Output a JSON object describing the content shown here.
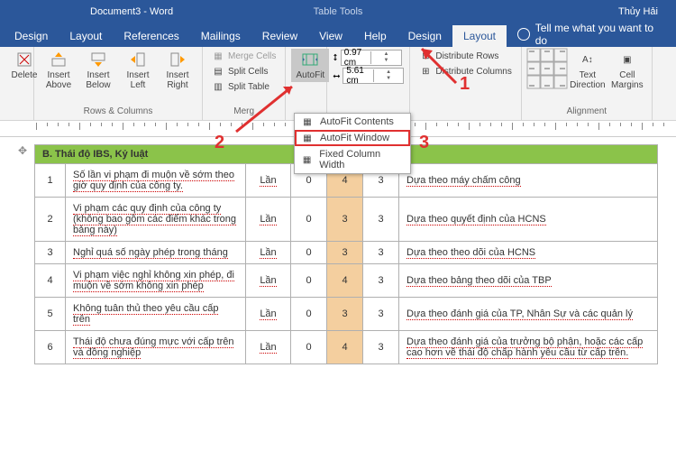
{
  "title": {
    "doc": "Document3  -  Word",
    "tools": "Table Tools",
    "user": "Thủy Hải"
  },
  "tabs": [
    "Design",
    "Layout",
    "References",
    "Mailings",
    "Review",
    "View",
    "Help",
    "Design",
    "Layout"
  ],
  "active_tab": 8,
  "tell_me": "Tell me what you want to do",
  "ribbon": {
    "delete": "Delete",
    "insert_above": "Insert Above",
    "insert_below": "Insert Below",
    "insert_left": "Insert Left",
    "insert_right": "Insert Right",
    "rows_cols": "Rows & Columns",
    "merge_cells": "Merge Cells",
    "split_cells": "Split Cells",
    "split_table": "Split Table",
    "merge": "Merg",
    "autofit": "AutoFit",
    "h": "0.97 cm",
    "w": "5.61 cm",
    "dist_rows": "Distribute Rows",
    "dist_cols": "Distribute Columns",
    "text_dir": "Text Direction",
    "cell_marg": "Cell Margins",
    "alignment": "Alignment"
  },
  "dropdown": {
    "a": "AutoFit Contents",
    "b": "AutoFit Window",
    "c": "Fixed Column Width"
  },
  "labels": {
    "n1": "1",
    "n2": "2",
    "n3": "3"
  },
  "header": "B. Thái độ IBS, Kỷ luật",
  "rows": [
    {
      "n": "1",
      "d": "Số lần vi phạm đi muộn về sớm theo giờ quy định của công ty.",
      "u": "Lần",
      "a": "0",
      "b": "4",
      "c": "3",
      "r": "Dựa theo máy chấm công"
    },
    {
      "n": "2",
      "d": "Vi phạm các quy định của công ty (không bao gồm các điểm khác trong bảng này)",
      "u": "Lần",
      "a": "0",
      "b": "3",
      "c": "3",
      "r": "Dựa theo quyết định của HCNS"
    },
    {
      "n": "3",
      "d": "Nghỉ quá số ngày phép trong tháng",
      "u": "Lần",
      "a": "0",
      "b": "3",
      "c": "3",
      "r": "Dựa theo theo dõi của HCNS"
    },
    {
      "n": "4",
      "d": "Vi phạm việc nghỉ không xin phép, đi muộn về sớm không xin phép",
      "u": "Lần",
      "a": "0",
      "b": "4",
      "c": "3",
      "r": "Dựa theo bảng theo dõi của TBP"
    },
    {
      "n": "5",
      "d": "Không tuân thủ theo yêu cầu cấp trên",
      "u": "Lần",
      "a": "0",
      "b": "3",
      "c": "3",
      "r": "Dựa theo đánh giá của TP, Nhân Sự và các quản lý"
    },
    {
      "n": "6",
      "d": "Thái độ chưa đúng mực với cấp trên và đồng nghiệp",
      "u": "Lần",
      "a": "0",
      "b": "4",
      "c": "3",
      "r": "Dựa theo đánh giá của trưởng bộ phận, hoặc các cấp cao hơn về thái độ chấp hành yêu cầu từ cấp trên."
    }
  ]
}
